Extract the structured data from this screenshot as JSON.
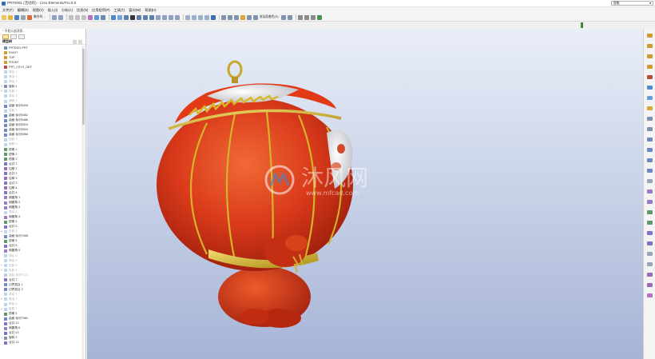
{
  "window": {
    "title": "PRT0001 (活动的) - Creo Elements/Pro 5.0",
    "controls": [
      "–",
      "□",
      "✕"
    ]
  },
  "menu": [
    "文件(F)",
    "编辑(E)",
    "视图(V)",
    "插入(I)",
    "分析(A)",
    "信息(N)",
    "应用程序(P)",
    "工具(T)",
    "窗口(W)",
    "帮助(H)"
  ],
  "toolbar": {
    "label_a": "集合时...",
    "label_b": "渲染面着色(S)"
  },
  "filter": {
    "value": "智能"
  },
  "left_panel": {
    "hint": "* 不显示选项项...",
    "header_title": "模型树"
  },
  "tree_rows": [
    {
      "label": "PRT0001.PRT",
      "icon": "part-icon",
      "exp": "",
      "dim": false
    },
    {
      "label": "RIGHT",
      "icon": "datum-plane-icon",
      "exp": "",
      "dim": false
    },
    {
      "label": "TOP",
      "icon": "datum-plane-icon",
      "exp": "",
      "dim": false
    },
    {
      "label": "FRONT",
      "icon": "datum-plane-icon",
      "exp": "",
      "dim": false
    },
    {
      "label": "PRT_CSYS_DEF",
      "icon": "csys-icon",
      "exp": "",
      "dim": false
    },
    {
      "label": "草绘 1",
      "icon": "sketch-icon",
      "exp": "",
      "dim": true
    },
    {
      "label": "基准 1",
      "icon": "sketch-icon",
      "exp": "",
      "dim": true
    },
    {
      "label": "草绘 2",
      "icon": "sketch-icon",
      "exp": "",
      "dim": true
    },
    {
      "label": "旋转 1",
      "icon": "revolve-icon",
      "exp": "+",
      "dim": false
    },
    {
      "label": "投影 1",
      "icon": "sketch-icon",
      "exp": "+",
      "dim": true
    },
    {
      "label": "草绘 3",
      "icon": "sketch-icon",
      "exp": "",
      "dim": true
    },
    {
      "label": "偏移 1",
      "icon": "sketch-icon",
      "exp": "",
      "dim": true
    },
    {
      "label": "曲面 标识5404",
      "icon": "surface-icon",
      "exp": "",
      "dim": false
    },
    {
      "label": "投影 2",
      "icon": "sketch-icon",
      "exp": "",
      "dim": true
    },
    {
      "label": "曲面 标识5462",
      "icon": "surface-icon",
      "exp": "",
      "dim": false
    },
    {
      "label": "曲面 标识5486",
      "icon": "surface-icon",
      "exp": "",
      "dim": false
    },
    {
      "label": "曲面 标识5510",
      "icon": "surface-icon",
      "exp": "",
      "dim": false
    },
    {
      "label": "曲面 标识5534",
      "icon": "surface-icon",
      "exp": "",
      "dim": false
    },
    {
      "label": "曲面 标识5558",
      "icon": "surface-icon",
      "exp": "",
      "dim": false
    },
    {
      "label": "投影 3",
      "icon": "sketch-icon",
      "exp": "",
      "dim": true
    },
    {
      "label": "偏移 2",
      "icon": "sketch-icon",
      "exp": "",
      "dim": true
    },
    {
      "label": "镜像 1",
      "icon": "mirror-icon",
      "exp": "",
      "dim": false
    },
    {
      "label": "镜像 2",
      "icon": "mirror-icon",
      "exp": "",
      "dim": false
    },
    {
      "label": "镜像 3",
      "icon": "mirror-icon",
      "exp": "",
      "dim": false
    },
    {
      "label": "合并 1",
      "icon": "merge-icon",
      "exp": "",
      "dim": false
    },
    {
      "label": "加厚 2",
      "icon": "thicken-icon",
      "exp": "",
      "dim": false
    },
    {
      "label": "合并 2",
      "icon": "merge-icon",
      "exp": "",
      "dim": false
    },
    {
      "label": "加厚 3",
      "icon": "thicken-icon",
      "exp": "",
      "dim": false
    },
    {
      "label": "合并 3",
      "icon": "merge-icon",
      "exp": "",
      "dim": false
    },
    {
      "label": "加厚 4",
      "icon": "thicken-icon",
      "exp": "",
      "dim": false
    },
    {
      "label": "合并 4",
      "icon": "merge-icon",
      "exp": "",
      "dim": false
    },
    {
      "label": "倒圆角 1",
      "icon": "round-icon",
      "exp": "",
      "dim": false
    },
    {
      "label": "倒圆角 2",
      "icon": "round-icon",
      "exp": "",
      "dim": false
    },
    {
      "label": "倒圆角 3",
      "icon": "round-icon",
      "exp": "",
      "dim": false
    },
    {
      "label": "草绘 4",
      "icon": "sketch-icon",
      "exp": "",
      "dim": true
    },
    {
      "label": "倒圆角 4",
      "icon": "round-icon",
      "exp": "",
      "dim": false
    },
    {
      "label": "镜像 4",
      "icon": "mirror-icon",
      "exp": "",
      "dim": false
    },
    {
      "label": "合并 5",
      "icon": "merge-icon",
      "exp": "",
      "dim": false
    },
    {
      "label": "投影 4",
      "icon": "sketch-icon",
      "exp": "+",
      "dim": true
    },
    {
      "label": "曲面 标识7608",
      "icon": "surface-icon",
      "exp": "",
      "dim": false
    },
    {
      "label": "镜像 5",
      "icon": "mirror-icon",
      "exp": "",
      "dim": false
    },
    {
      "label": "合并 6",
      "icon": "merge-icon",
      "exp": "",
      "dim": false
    },
    {
      "label": "倒圆角 5",
      "icon": "round-icon",
      "exp": "",
      "dim": false
    },
    {
      "label": "草绘 5",
      "icon": "sketch-icon",
      "exp": "",
      "dim": true
    },
    {
      "label": "草绘 6",
      "icon": "sketch-icon",
      "exp": "",
      "dim": true
    },
    {
      "label": "投影 5",
      "icon": "sketch-icon",
      "exp": "+",
      "dim": true
    },
    {
      "label": "投影 6",
      "icon": "sketch-icon",
      "exp": "+",
      "dim": true
    },
    {
      "label": "复制 标识7722",
      "icon": "surface-icon",
      "exp": "",
      "dim": true
    },
    {
      "label": "合并 7",
      "icon": "merge-icon",
      "exp": "",
      "dim": false
    },
    {
      "label": "边界混合 1",
      "icon": "blend-icon",
      "exp": "",
      "dim": false
    },
    {
      "label": "边界混合 2",
      "icon": "blend-icon",
      "exp": "",
      "dim": false
    },
    {
      "label": "草绘 7",
      "icon": "sketch-icon",
      "exp": "",
      "dim": true
    },
    {
      "label": "基准 2",
      "icon": "sketch-icon",
      "exp": "+",
      "dim": true
    },
    {
      "label": "草绘 8",
      "icon": "sketch-icon",
      "exp": "",
      "dim": true
    },
    {
      "label": "投影 7",
      "icon": "sketch-icon",
      "exp": "+",
      "dim": true
    },
    {
      "label": "镜像 6",
      "icon": "mirror-icon",
      "exp": "",
      "dim": false
    },
    {
      "label": "曲面 标识7981",
      "icon": "surface-icon",
      "exp": "",
      "dim": false
    },
    {
      "label": "合并 12",
      "icon": "merge-icon",
      "exp": "",
      "dim": false
    },
    {
      "label": "倒圆角 6",
      "icon": "round-icon",
      "exp": "",
      "dim": false
    },
    {
      "label": "合并 13",
      "icon": "merge-icon",
      "exp": "",
      "dim": false
    },
    {
      "label": "旋转 2",
      "icon": "revolve-icon",
      "exp": "+",
      "dim": false
    },
    {
      "label": "合并 14",
      "icon": "merge-icon",
      "exp": "",
      "dim": false
    }
  ],
  "watermark": {
    "cn": "沐风网",
    "url": "www.mfcad.com"
  },
  "colors": {
    "lantern_red": "#d4361a",
    "gold_trim": "#c6a823",
    "viewport_top": "#e9eef8",
    "viewport_bottom": "#a6b4d6"
  }
}
